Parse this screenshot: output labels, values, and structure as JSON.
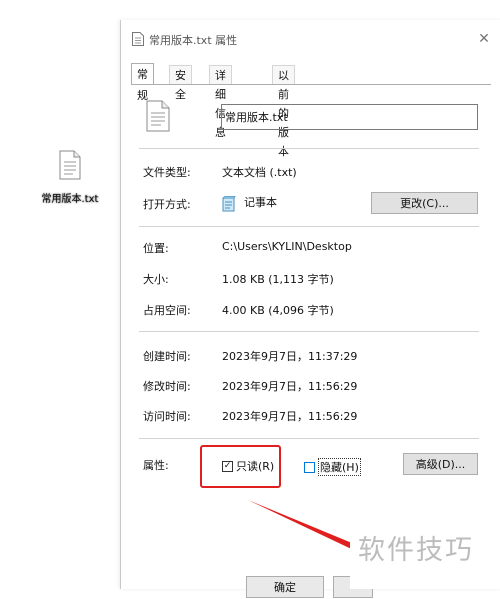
{
  "desktop": {
    "file_label": "常用版本.txt"
  },
  "dialog": {
    "title": "常用版本.txt 属性",
    "close_glyph": "✕",
    "tabs": [
      "常规",
      "安全",
      "详细信息",
      "以前的版本"
    ],
    "file_name": "常用版本.txt",
    "file_type": {
      "label": "文件类型:",
      "value": "文本文档 (.txt)"
    },
    "open_with": {
      "label": "打开方式:",
      "value": "记事本",
      "button": "更改(C)..."
    },
    "location": {
      "label": "位置:",
      "value": "C:\\Users\\KYLIN\\Desktop"
    },
    "size": {
      "label": "大小:",
      "value": "1.08 KB (1,113 字节)"
    },
    "size_on_disk": {
      "label": "占用空间:",
      "value": "4.00 KB (4,096 字节)"
    },
    "created": {
      "label": "创建时间:",
      "value": "2023年9月7日，11:37:29"
    },
    "modified": {
      "label": "修改时间:",
      "value": "2023年9月7日，11:56:29"
    },
    "accessed": {
      "label": "访问时间:",
      "value": "2023年9月7日，11:56:29"
    },
    "attributes": {
      "label": "属性:",
      "readonly": "只读(R)",
      "readonly_checked": true,
      "hidden": "隐藏(H)",
      "hidden_checked": false,
      "advanced": "高级(D)..."
    },
    "bottom_buttons": [
      "确定"
    ]
  },
  "watermark": "软件技巧",
  "colors": {
    "highlight": "#e02020",
    "accent": "#0078d7"
  }
}
